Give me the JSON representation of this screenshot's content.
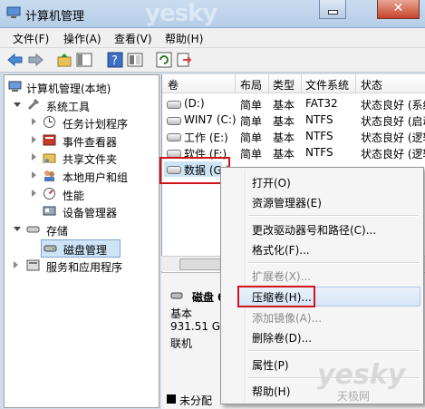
{
  "window": {
    "title": "计算机管理",
    "watermark": "yesky"
  },
  "menu": [
    "文件(F)",
    "操作(A)",
    "查看(V)",
    "帮助(H)"
  ],
  "tree": {
    "root": "计算机管理(本地)",
    "system_tools": "系统工具",
    "task_scheduler": "任务计划程序",
    "event_viewer": "事件查看器",
    "shared_folders": "共享文件夹",
    "local_users": "本地用户和组",
    "performance": "性能",
    "device_manager": "设备管理器",
    "storage": "存储",
    "disk_management": "磁盘管理",
    "services_apps": "服务和应用程序"
  },
  "table": {
    "headers": [
      "卷",
      "布局",
      "类型",
      "文件系统",
      "状态"
    ],
    "rows": [
      {
        "vol": "(D:)",
        "layout": "简单",
        "type": "基本",
        "fs": "FAT32",
        "status": "状态良好 (系统"
      },
      {
        "vol": "WIN7 (C:)",
        "layout": "简单",
        "type": "基本",
        "fs": "NTFS",
        "status": "状态良好 (启动"
      },
      {
        "vol": "工作 (E:)",
        "layout": "简单",
        "type": "基本",
        "fs": "NTFS",
        "status": "状态良好 (逻辑"
      },
      {
        "vol": "软件 (F:)",
        "layout": "简单",
        "type": "基本",
        "fs": "NTFS",
        "status": "状态良好 (逻辑"
      },
      {
        "vol": "数据 (G:)",
        "layout": "",
        "type": "",
        "fs": "",
        "status": ""
      }
    ]
  },
  "disk_panel": {
    "name": "磁盘 0",
    "type": "基本",
    "size": "931.51 GB",
    "state": "联机",
    "legend_unallocated": "未分配"
  },
  "context_menu": {
    "items": [
      {
        "label": "打开(O)",
        "disabled": false
      },
      {
        "label": "资源管理器(E)",
        "disabled": false
      },
      {
        "label": "更改驱动器号和路径(C)...",
        "disabled": false
      },
      {
        "label": "格式化(F)...",
        "disabled": false
      },
      {
        "label": "扩展卷(X)...",
        "disabled": true
      },
      {
        "label": "压缩卷(H)...",
        "disabled": false
      },
      {
        "label": "添加镜像(A)...",
        "disabled": true
      },
      {
        "label": "删除卷(D)...",
        "disabled": false
      },
      {
        "label": "属性(P)",
        "disabled": false
      },
      {
        "label": "帮助(H)",
        "disabled": false
      }
    ]
  },
  "corner_watermark": {
    "logo": "yesky",
    "subtitle": "天极网"
  },
  "colors": {
    "highlight_red": "#d0141c",
    "selection_blue": "#cde4f7"
  }
}
